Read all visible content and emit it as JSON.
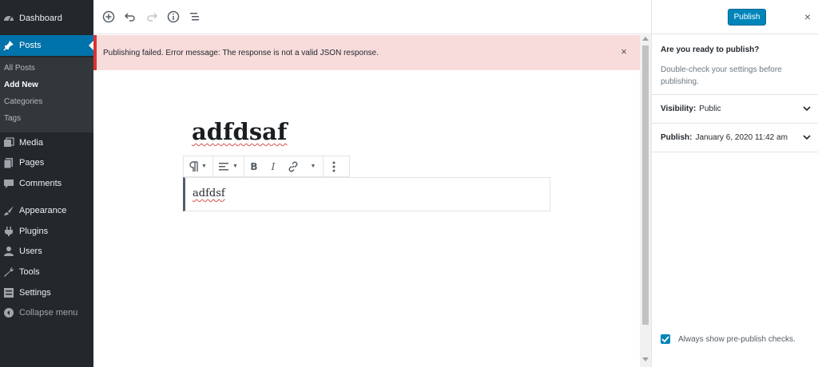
{
  "admin_menu": {
    "items": [
      {
        "label": "Dashboard",
        "icon": "dashboard-icon"
      },
      {
        "label": "Posts",
        "icon": "pin-icon",
        "active": true
      },
      {
        "label": "Media",
        "icon": "media-icon"
      },
      {
        "label": "Pages",
        "icon": "pages-icon"
      },
      {
        "label": "Comments",
        "icon": "comments-icon"
      },
      {
        "label": "Appearance",
        "icon": "brush-icon"
      },
      {
        "label": "Plugins",
        "icon": "plugin-icon"
      },
      {
        "label": "Users",
        "icon": "user-icon"
      },
      {
        "label": "Tools",
        "icon": "wrench-icon"
      },
      {
        "label": "Settings",
        "icon": "settings-icon"
      },
      {
        "label": "Collapse menu",
        "icon": "collapse-icon"
      }
    ],
    "submenu": [
      {
        "label": "All Posts"
      },
      {
        "label": "Add New",
        "current": true
      },
      {
        "label": "Categories"
      },
      {
        "label": "Tags"
      }
    ]
  },
  "toolbar": {
    "icons": [
      "add-block-icon",
      "undo-icon",
      "redo-icon",
      "info-icon",
      "outline-icon"
    ]
  },
  "notice": {
    "text": "Publishing failed. Error message: The response is not a valid JSON response.",
    "close_label": "×"
  },
  "editor": {
    "title": "adfdsaf",
    "paragraph": "adfdsf",
    "block_toolbar": [
      "paragraph-icon",
      "align-icon",
      "bold-icon",
      "italic-icon",
      "link-icon",
      "more-options-icon"
    ]
  },
  "publish_panel": {
    "publish_button": "Publish",
    "close_label": "×",
    "heading": "Are you ready to publish?",
    "description": "Double-check your settings before publishing.",
    "visibility_label": "Visibility:",
    "visibility_value": "Public",
    "publish_label": "Publish:",
    "publish_value": "January 6, 2020 11:42 am",
    "always_show_label": "Always show pre-publish checks.",
    "always_show_checked": true
  },
  "colors": {
    "sidebar_bg": "#23282d",
    "accent": "#0073aa",
    "publish_button": "#0085ba",
    "notice_bg": "#f8dcdc",
    "notice_border": "#dc3232"
  }
}
